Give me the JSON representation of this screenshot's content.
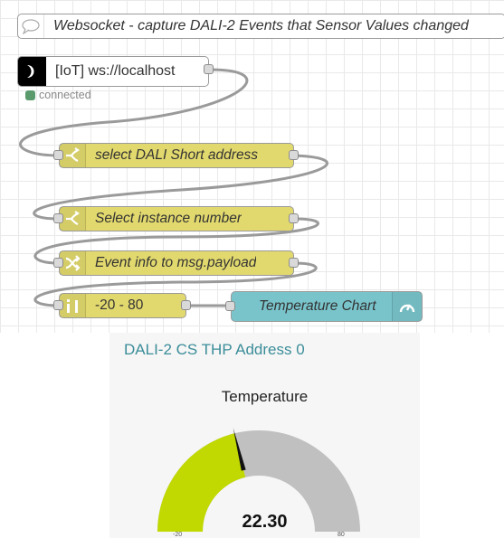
{
  "flow": {
    "comment": {
      "label": "Websocket - capture DALI-2 Events that Sensor Values changed",
      "icon": "comment-bubble-icon"
    },
    "websocket": {
      "label": "[IoT] ws://localhost",
      "status": "connected",
      "status_color": "#5a9a6c",
      "icon": "websocket-icon"
    },
    "nodes": [
      {
        "label": "select DALI Short address",
        "icon": "switch-icon"
      },
      {
        "label": "Select instance number",
        "icon": "switch-icon"
      },
      {
        "label": "Event info to msg.payload",
        "icon": "change-icon"
      },
      {
        "label": "-20 - 80",
        "icon": "range-icon"
      }
    ],
    "gauge_node": {
      "label": "Temperature Chart",
      "icon": "gauge-icon"
    }
  },
  "colors": {
    "function_node": "#e2d96e",
    "dashboard_node": "#79c4cb",
    "gauge_fill": "#c1d900",
    "gauge_track": "#c0c0c0",
    "group_title": "#3b8d99"
  },
  "dashboard": {
    "group_title": "DALI-2 CS THP Address 0",
    "gauge": {
      "title": "Temperature",
      "value": 22.3,
      "value_label": "22.30",
      "min": -20,
      "max": 80,
      "min_label": "-20",
      "max_label": "80"
    }
  }
}
